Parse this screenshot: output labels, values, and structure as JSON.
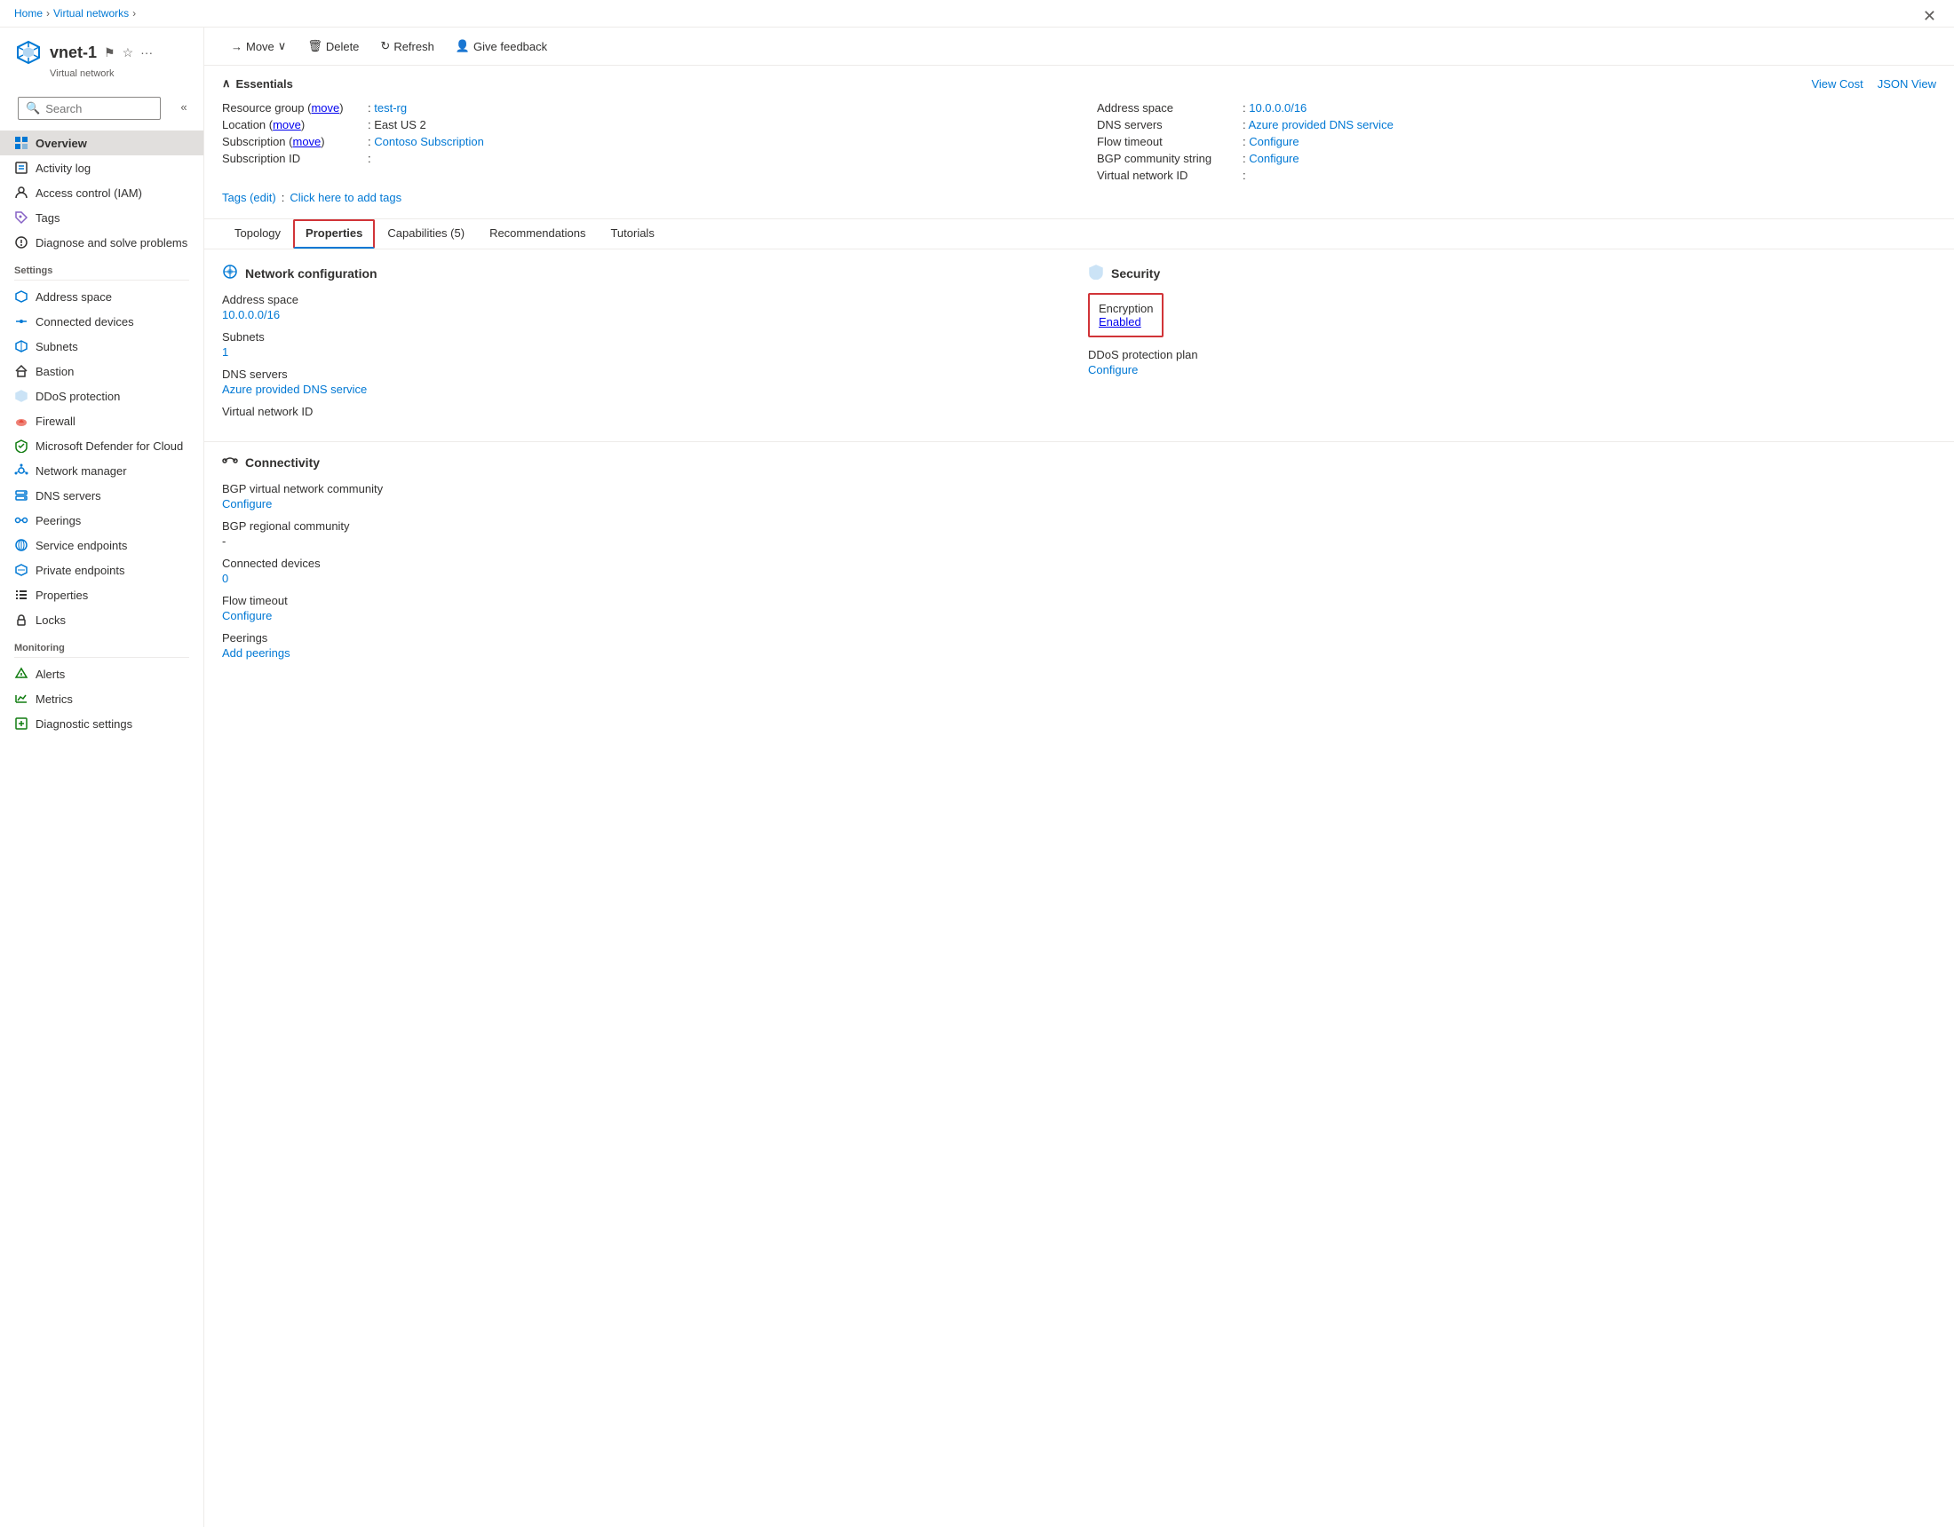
{
  "breadcrumb": {
    "home": "Home",
    "virtual_networks": "Virtual networks",
    "sep1": ">",
    "sep2": ">"
  },
  "header": {
    "resource_name": "vnet-1",
    "resource_type": "Virtual network"
  },
  "search": {
    "placeholder": "Search"
  },
  "toolbar": {
    "move_label": "Move",
    "delete_label": "Delete",
    "refresh_label": "Refresh",
    "give_feedback_label": "Give feedback"
  },
  "essentials": {
    "title": "Essentials",
    "view_cost": "View Cost",
    "json_view": "JSON View",
    "fields_left": [
      {
        "label": "Resource group (move)",
        "value": ": test-rg",
        "link": "test-rg"
      },
      {
        "label": "Location (move)",
        "value": ": East US 2"
      },
      {
        "label": "Subscription (move)",
        "value": ": Contoso Subscription",
        "link": "Contoso Subscription"
      },
      {
        "label": "Subscription ID",
        "value": ":"
      }
    ],
    "fields_right": [
      {
        "label": "Address space",
        "value": ": 10.0.0.0/16",
        "link": "10.0.0.0/16"
      },
      {
        "label": "DNS servers",
        "value": ": Azure provided DNS service",
        "link": "Azure provided DNS service"
      },
      {
        "label": "Flow timeout",
        "value": ": Configure",
        "link": "Configure"
      },
      {
        "label": "BGP community string",
        "value": ": Configure",
        "link": "Configure"
      },
      {
        "label": "Virtual network ID",
        "value": ":"
      }
    ],
    "tags_label": "Tags (edit)",
    "tags_action": "Click here to add tags"
  },
  "tabs": [
    {
      "id": "topology",
      "label": "Topology"
    },
    {
      "id": "properties",
      "label": "Properties",
      "active": true
    },
    {
      "id": "capabilities",
      "label": "Capabilities (5)"
    },
    {
      "id": "recommendations",
      "label": "Recommendations"
    },
    {
      "id": "tutorials",
      "label": "Tutorials"
    }
  ],
  "network_config": {
    "section_title": "Network configuration",
    "items": [
      {
        "label": "Address space",
        "value": "10.0.0.0/16",
        "is_link": true
      },
      {
        "label": "Subnets",
        "value": "1",
        "is_link": true
      },
      {
        "label": "DNS servers",
        "value": ""
      },
      {
        "label_dns_value": "Azure provided DNS service",
        "is_link": true
      },
      {
        "label": "Virtual network ID",
        "value": ""
      }
    ]
  },
  "security": {
    "section_title": "Security",
    "encryption_label": "Encryption",
    "encryption_value": "Enabled",
    "ddos_label": "DDoS protection plan",
    "ddos_value": "Configure"
  },
  "connectivity": {
    "section_title": "Connectivity",
    "items": [
      {
        "label": "BGP virtual network community",
        "value": ""
      },
      {
        "label_config": "Configure",
        "is_link": true
      },
      {
        "label": "BGP regional community",
        "value": "-"
      },
      {
        "label": "Connected devices",
        "value": ""
      },
      {
        "label_count": "0",
        "is_link": true
      },
      {
        "label": "Flow timeout",
        "value": ""
      },
      {
        "label_flow": "Configure",
        "is_link": true
      },
      {
        "label": "Peerings",
        "value": ""
      },
      {
        "label_peerings": "Add peerings",
        "is_link": true
      }
    ]
  },
  "sidebar": {
    "nav_items": [
      {
        "id": "overview",
        "label": "Overview",
        "active": true,
        "icon": "overview"
      },
      {
        "id": "activity-log",
        "label": "Activity log",
        "icon": "activity"
      },
      {
        "id": "access-control",
        "label": "Access control (IAM)",
        "icon": "iam"
      },
      {
        "id": "tags",
        "label": "Tags",
        "icon": "tags"
      },
      {
        "id": "diagnose",
        "label": "Diagnose and solve problems",
        "icon": "diagnose"
      }
    ],
    "settings_label": "Settings",
    "settings_items": [
      {
        "id": "address-space",
        "label": "Address space",
        "icon": "address"
      },
      {
        "id": "connected-devices",
        "label": "Connected devices",
        "icon": "connected"
      },
      {
        "id": "subnets",
        "label": "Subnets",
        "icon": "subnets"
      },
      {
        "id": "bastion",
        "label": "Bastion",
        "icon": "bastion"
      },
      {
        "id": "ddos",
        "label": "DDoS protection",
        "icon": "ddos"
      },
      {
        "id": "firewall",
        "label": "Firewall",
        "icon": "firewall"
      },
      {
        "id": "defender",
        "label": "Microsoft Defender for Cloud",
        "icon": "defender"
      },
      {
        "id": "network-manager",
        "label": "Network manager",
        "icon": "netmgr"
      },
      {
        "id": "dns-servers",
        "label": "DNS servers",
        "icon": "dns"
      },
      {
        "id": "peerings",
        "label": "Peerings",
        "icon": "peerings"
      },
      {
        "id": "service-endpoints",
        "label": "Service endpoints",
        "icon": "service"
      },
      {
        "id": "private-endpoints",
        "label": "Private endpoints",
        "icon": "private"
      },
      {
        "id": "properties",
        "label": "Properties",
        "icon": "properties"
      },
      {
        "id": "locks",
        "label": "Locks",
        "icon": "locks"
      }
    ],
    "monitoring_label": "Monitoring",
    "monitoring_items": [
      {
        "id": "alerts",
        "label": "Alerts",
        "icon": "alerts"
      },
      {
        "id": "metrics",
        "label": "Metrics",
        "icon": "metrics"
      },
      {
        "id": "diagnostic-settings",
        "label": "Diagnostic settings",
        "icon": "diagnostic"
      }
    ]
  }
}
